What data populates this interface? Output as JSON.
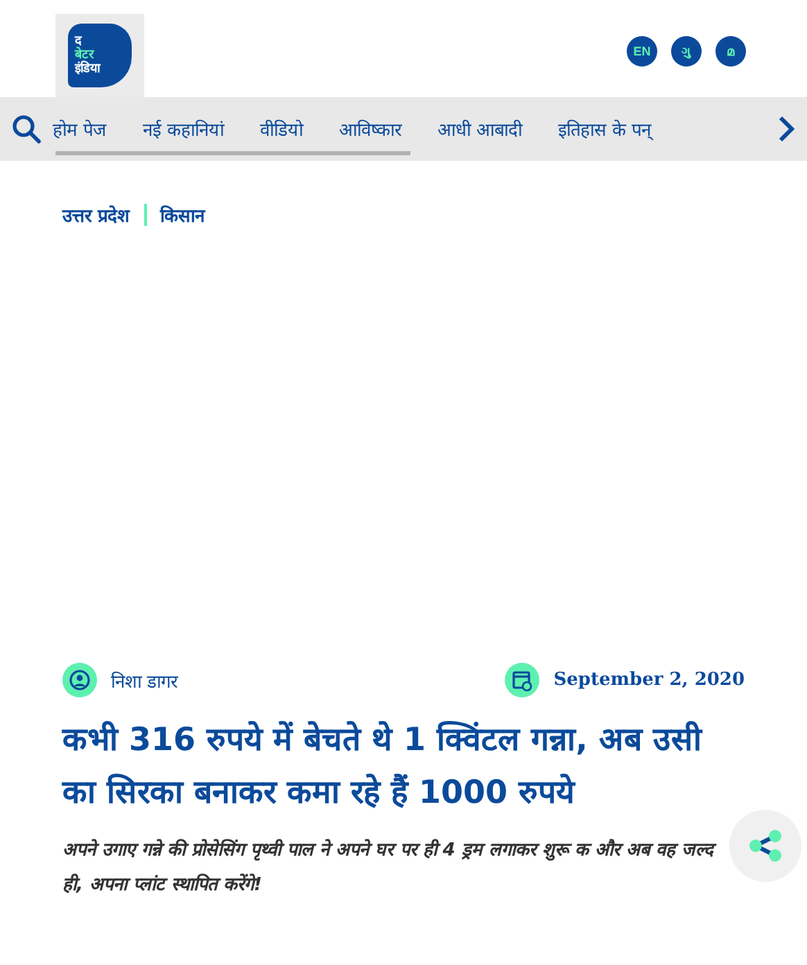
{
  "logo": {
    "lines": [
      "द",
      "बेटर",
      "इंडिया"
    ]
  },
  "languages": [
    "EN",
    "ગુ",
    "മ"
  ],
  "nav": {
    "items": [
      "होम पेज",
      "नई कहानियां",
      "वीडियो",
      "आविष्कार",
      "आधी आबादी",
      "इतिहास के पन्"
    ]
  },
  "categories": [
    "उत्तर प्रदेश",
    "किसान"
  ],
  "article": {
    "author": "निशा डागर",
    "date": "September 2, 2020",
    "title": "कभी 316 रुपये में बेचते थे 1 क्विंटल गन्ना, अब उसी का सिरका बनाकर कमा रहे हैं 1000 रुपये",
    "summary": "अपने उगाए गन्ने की प्रोसेसिंग पृथ्वी पाल ने अपने घर पर ही 4 ड्रम लगाकर शुरू क और अब वह जल्द ही, अपना प्लांट स्थापित करेंगे!"
  }
}
